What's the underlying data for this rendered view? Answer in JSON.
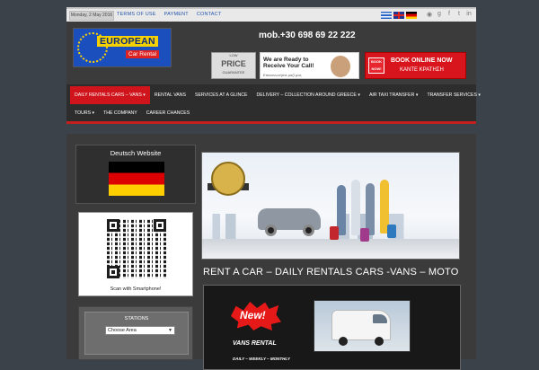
{
  "topbar": {
    "date": "Monday, 2 May 2016",
    "links": [
      "TERMS OF USE",
      "PAYMENT",
      "CONTACT"
    ],
    "social_icons": [
      "rss-icon",
      "google-plus-icon",
      "facebook-icon",
      "twitter-icon",
      "linkedin-icon"
    ]
  },
  "header": {
    "logo_line1": "EUROPEAN",
    "logo_line2": "Car Rental",
    "phone": "mob.+30 698 69 22 222",
    "low_price_top": "LOW",
    "low_price_main": "PRICE",
    "low_price_sub": "GUARANTEE",
    "call_text": "We are Ready to Receive Your Call!",
    "call_sub": "Επικοινωνήστε μαζί μας",
    "book_tag": "BOOK NOW!",
    "book_line1": "BOOK ONLINE NOW",
    "book_line2": "ΚΑΝΤΕ ΚΡΑΤΗΣΗ"
  },
  "nav": {
    "row1": [
      {
        "label": "DAILY RENTALS CARS – VANS ▾",
        "active": true
      },
      {
        "label": "RENTAL VANS",
        "active": false
      },
      {
        "label": "SERVICES AT A GLINCE",
        "active": false
      },
      {
        "label": "DELIVERY – COLLECTION AROUND GREECE ▾",
        "active": false
      },
      {
        "label": "AIR TAXI TRANSFER ▾",
        "active": false
      },
      {
        "label": "TRANSFER SERVICES ▾",
        "active": false
      }
    ],
    "row2": [
      {
        "label": "TOURS ▾",
        "active": false
      },
      {
        "label": "THE COMPANY",
        "active": false
      },
      {
        "label": "CAREER CHANCES",
        "active": false
      }
    ]
  },
  "sidebar": {
    "deutsch_title": "Deutsch Website",
    "qr_caption": "Scan with Smartphone!",
    "stations_label": "STATIONS",
    "stations_select": "Choose Area"
  },
  "main": {
    "page_title": "RENT A CAR – DAILY RENTALS CARS -VANS – MOTO",
    "banner_new": "New!",
    "banner_vans": "VANS RENTAL",
    "banner_freq": "DAILY – WEEKLY – MONTHLY"
  },
  "colors": {
    "accent_red": "#d0141c",
    "background": "#3b4249",
    "panel": "#3b3b3b"
  }
}
